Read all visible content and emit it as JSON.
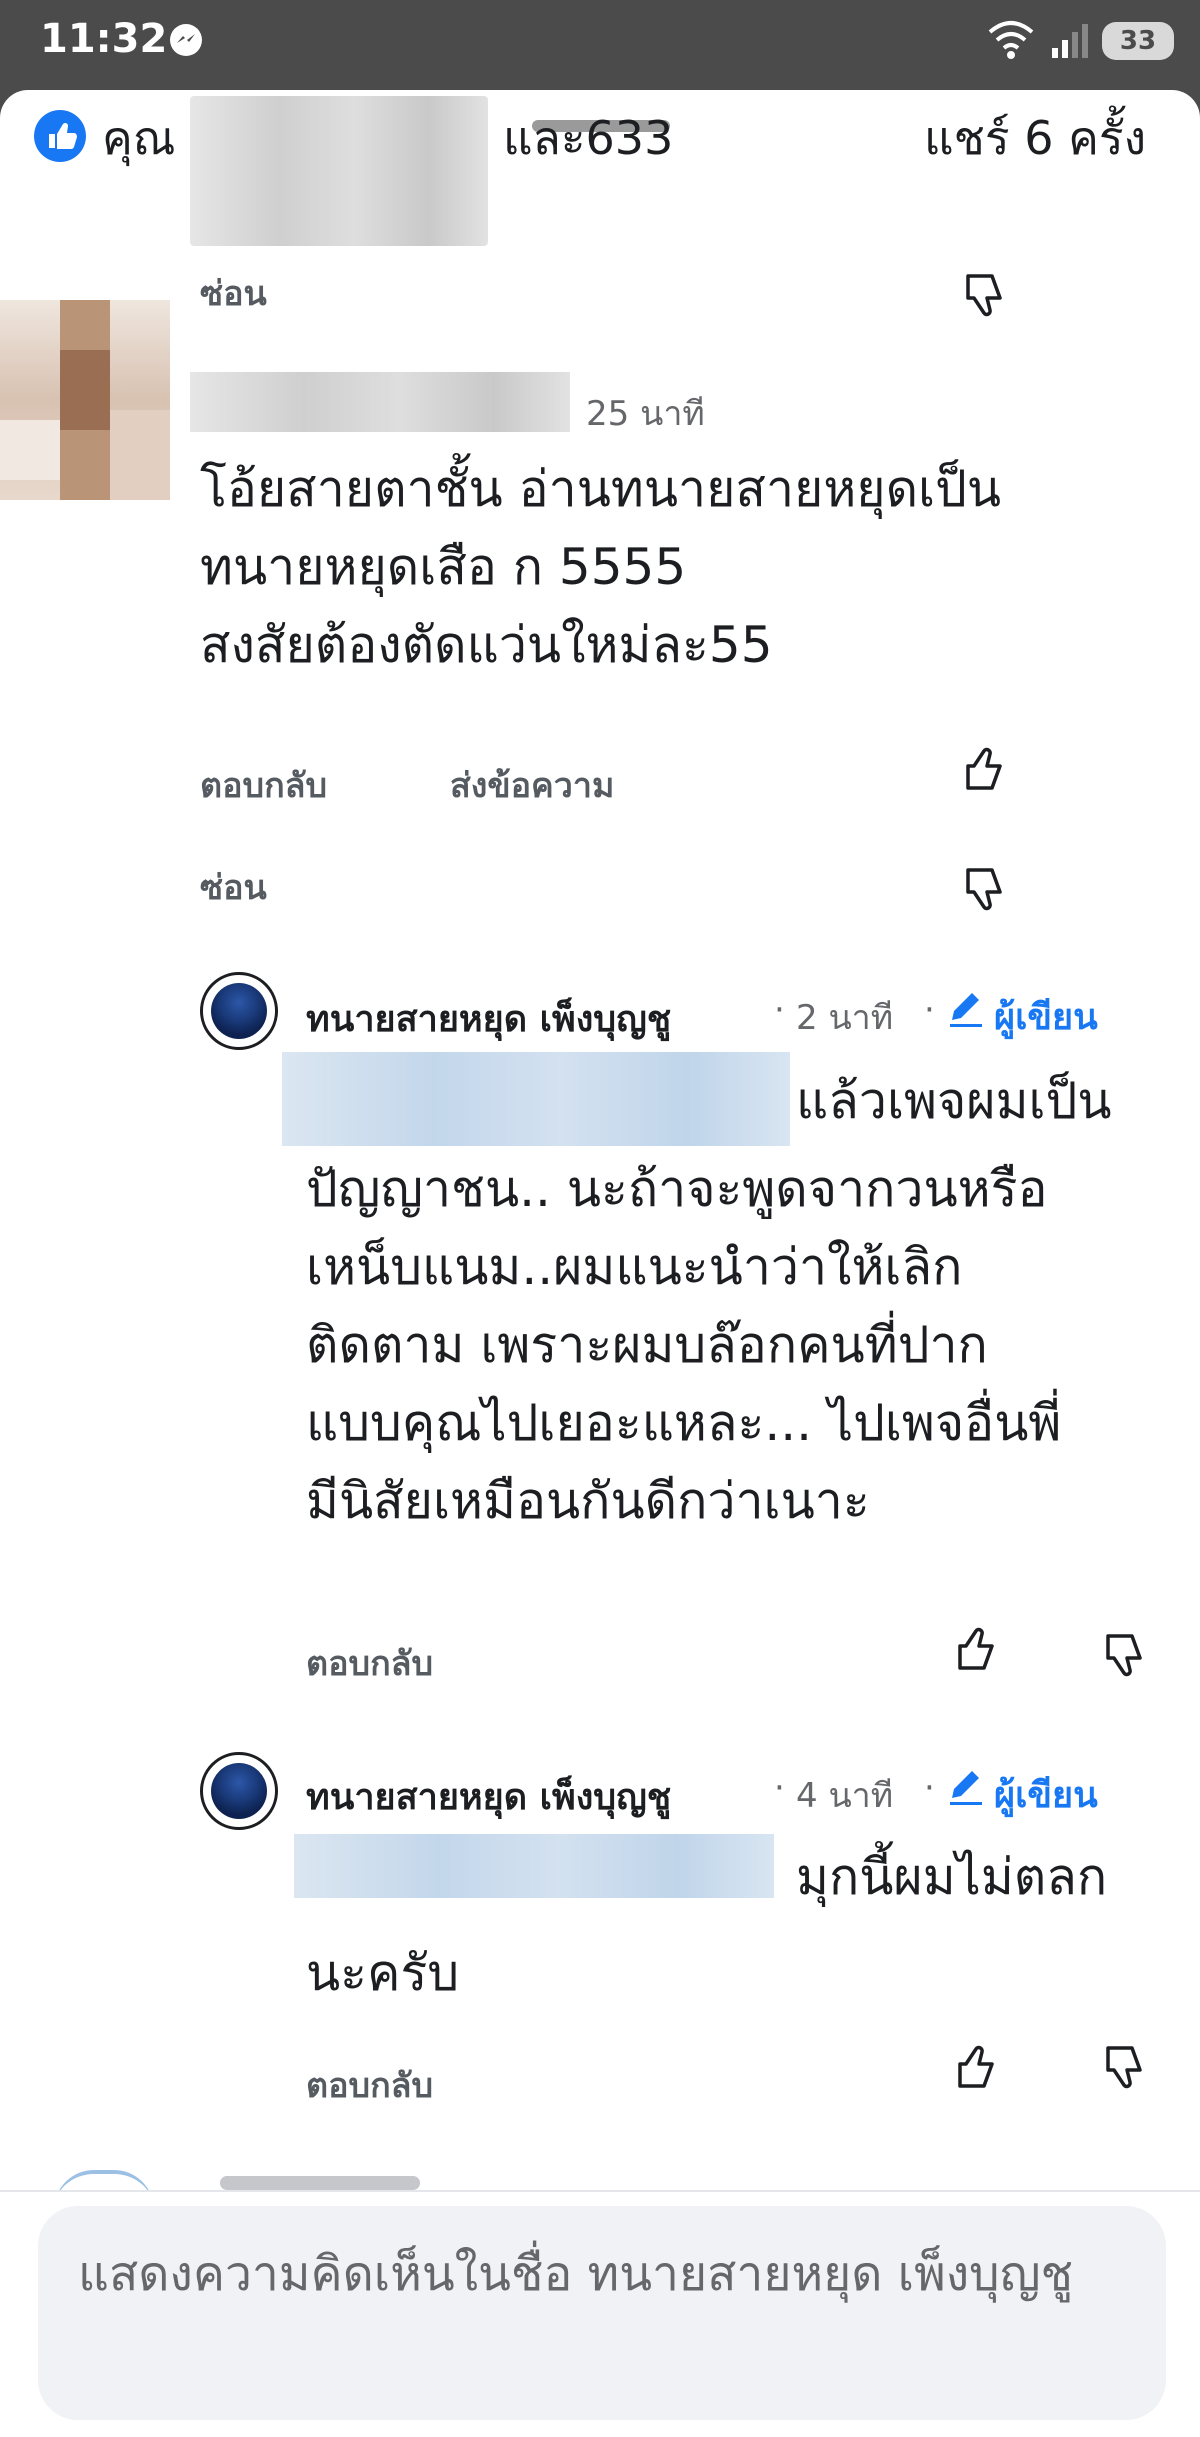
{
  "status_bar": {
    "time": "11:32",
    "battery": "33"
  },
  "reactions": {
    "prefix": "คุณ",
    "suffix": "และ633",
    "shares": "แชร์ 6 ครั้ง"
  },
  "comments": [
    {
      "hide_label": "ซ่อน"
    },
    {
      "time": "25 นาที",
      "text_lines": [
        "โอ้ยสายตาชั้น อ่านทนายสายหยุดเป็น",
        "ทนายหยุดเสือ ก 5555",
        "สงสัยต้องตัดแว่นใหม่ละ55"
      ],
      "reply_label": "ตอบกลับ",
      "message_label": "ส่งข้อความ",
      "hide_label": "ซ่อน"
    }
  ],
  "replies": [
    {
      "author": "ทนายสายหยุด เพ็งบุญชู",
      "dot": "·",
      "time": "2 นาที",
      "dot2": "·",
      "badge": "ผู้เขียน",
      "first_line_tail": "แล้วเพจผมเป็น",
      "text_lines": [
        "ปัญญาชน.. นะถ้าจะพูดจากวนหรือ",
        "เหน็บแนม..ผมแนะนำว่าให้เลิก",
        "ติดตาม เพราะผมบล๊อกคนที่ปาก",
        "แบบคุณไปเยอะแหละ... ไปเพจอื่นพี่",
        "มีนิสัยเหมือนกันดีกว่าเนาะ"
      ],
      "reply_label": "ตอบกลับ"
    },
    {
      "author": "ทนายสายหยุด เพ็งบุญชู",
      "dot": "·",
      "time": "4 นาที",
      "dot2": "·",
      "badge": "ผู้เขียน",
      "first_line_tail": "มุกนี้ผมไม่ตลก",
      "text_lines": [
        "นะครับ"
      ],
      "reply_label": "ตอบกลับ"
    }
  ],
  "composer": {
    "placeholder": "แสดงความคิดเห็นในชื่อ ทนายสายหยุด เพ็งบุญชู"
  },
  "colors": {
    "accent": "#1877f2",
    "status_bar": "#4b4b4b",
    "composer_bg": "#f0f2f5"
  }
}
